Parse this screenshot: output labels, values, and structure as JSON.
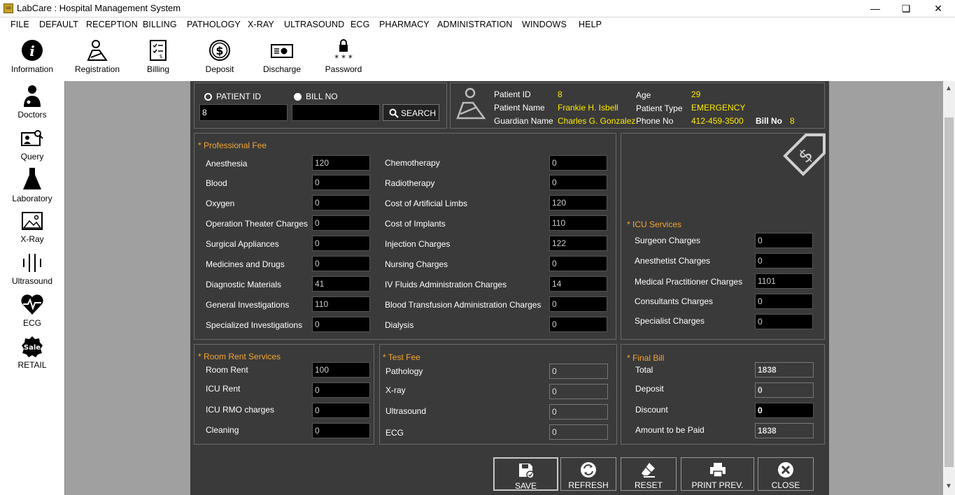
{
  "window": {
    "title": "LabCare : Hospital Management System",
    "icon_text": "lab"
  },
  "menu": [
    "FILE",
    "DEFAULT",
    "RECEPTION",
    "BILLING",
    "PATHOLOGY",
    "X-RAY",
    "ULTRASOUND",
    "ECG",
    "PHARMACY",
    "ADMINISTRATION",
    "WINDOWS",
    "HELP"
  ],
  "toolbar": {
    "information": "Information",
    "registration": "Registration",
    "billing": "Billing",
    "deposit": "Deposit",
    "discharge": "Discharge",
    "password": "Password"
  },
  "sidebar": {
    "doctors": "Doctors",
    "query": "Query",
    "laboratory": "Laboratory",
    "xray": "X-Ray",
    "ultrasound": "Ultrasound",
    "ecg": "ECG",
    "retail": "RETAIL",
    "sale_badge": "Sale"
  },
  "search": {
    "patient_id_label": "PATIENT ID",
    "bill_no_label": "BILL NO",
    "patient_id_value": "8",
    "bill_no_value": "",
    "search_label": "SEARCH"
  },
  "patient": {
    "labels": {
      "patient_id": "Patient ID",
      "patient_name": "Patient Name",
      "guardian_name": "Guardian Name",
      "age": "Age",
      "patient_type": "Patient Type",
      "phone_no": "Phone No",
      "bill_no": "Bill No"
    },
    "values": {
      "patient_id": "8",
      "patient_name": "Frankie H. Isbell",
      "guardian_name": "Charles G. Gonzalez",
      "age": "29",
      "patient_type": "EMERGENCY",
      "phone_no": "412-459-3500",
      "bill_no": "8"
    }
  },
  "professional_fee": {
    "title": "* Professional Fee",
    "left": [
      {
        "label": "Anesthesia",
        "value": "120"
      },
      {
        "label": "Blood",
        "value": "0"
      },
      {
        "label": "Oxygen",
        "value": "0"
      },
      {
        "label": "Operation Theater Charges",
        "value": "0"
      },
      {
        "label": "Surgical Appliances",
        "value": "0"
      },
      {
        "label": "Medicines and Drugs",
        "value": "0"
      },
      {
        "label": "Diagnostic Materials",
        "value": "41"
      },
      {
        "label": "General Investigations",
        "value": "110"
      },
      {
        "label": "Specialized Investigations",
        "value": "0"
      }
    ],
    "right": [
      {
        "label": "Chemotherapy",
        "value": "0"
      },
      {
        "label": "Radiotherapy",
        "value": "0"
      },
      {
        "label": "Cost of Artificial Limbs",
        "value": "120"
      },
      {
        "label": "Cost of Implants",
        "value": "110"
      },
      {
        "label": "Injection Charges",
        "value": "122"
      },
      {
        "label": "Nursing Charges",
        "value": "0"
      },
      {
        "label": "IV Fluids Administration Charges",
        "value": "14"
      },
      {
        "label": "Blood Transfusion Administration Charges",
        "value": "0"
      },
      {
        "label": "Dialysis",
        "value": "0"
      }
    ]
  },
  "icu_services": {
    "title": "* ICU Services",
    "items": [
      {
        "label": "Surgeon Charges",
        "value": "0"
      },
      {
        "label": "Anesthetist Charges",
        "value": "0"
      },
      {
        "label": "Medical Practitioner Charges",
        "value": "1101"
      },
      {
        "label": "Consultants Charges",
        "value": "0"
      },
      {
        "label": "Specialist Charges",
        "value": "0"
      }
    ]
  },
  "room_rent": {
    "title": "* Room Rent Services",
    "items": [
      {
        "label": "Room Rent",
        "value": "100"
      },
      {
        "label": "ICU Rent",
        "value": "0"
      },
      {
        "label": "ICU RMO charges",
        "value": "0"
      },
      {
        "label": "Cleaning",
        "value": "0"
      }
    ]
  },
  "test_fee": {
    "title": "* Test Fee",
    "items": [
      {
        "label": "Pathology",
        "value": "0"
      },
      {
        "label": "X-ray",
        "value": "0"
      },
      {
        "label": "Ultrasound",
        "value": "0"
      },
      {
        "label": "ECG",
        "value": "0"
      }
    ]
  },
  "final_bill": {
    "title": "* Final Bill",
    "items": [
      {
        "label": "Total",
        "value": "1838"
      },
      {
        "label": "Deposit",
        "value": "0"
      },
      {
        "label": "Discount",
        "value": "0"
      },
      {
        "label": "Amount to be Paid",
        "value": "1838"
      }
    ]
  },
  "actions": {
    "save": "SAVE",
    "refresh": "REFRESH",
    "reset": "RESET",
    "print_prev": "PRINT PREV.",
    "close": "CLOSE"
  },
  "colors": {
    "form_bg": "#3a3a3a",
    "section_title": "#f4a632",
    "info_value": "#ffea00",
    "workspace_bg": "#a0a0a0"
  }
}
